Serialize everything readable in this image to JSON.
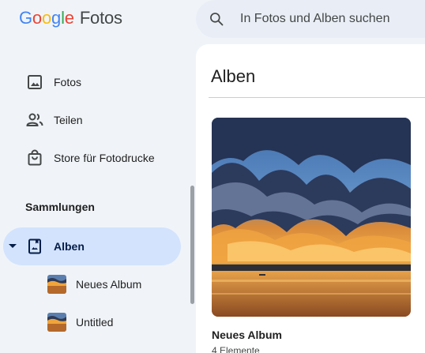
{
  "app": {
    "logo_letters": [
      "G",
      "o",
      "o",
      "g",
      "l",
      "e"
    ],
    "logo_colors": [
      "#4285f4",
      "#ea4335",
      "#fbbc05",
      "#4285f4",
      "#34a853",
      "#ea4335"
    ],
    "product_name": "Fotos"
  },
  "search": {
    "placeholder": "In Fotos und Alben suchen",
    "icon": "search-icon"
  },
  "sidebar": {
    "items": [
      {
        "label": "Fotos",
        "icon": "photo-icon"
      },
      {
        "label": "Teilen",
        "icon": "people-icon"
      },
      {
        "label": "Store für Fotodrucke",
        "icon": "shopping-bag-icon"
      }
    ],
    "section_title": "Sammlungen",
    "active_item": {
      "label": "Alben",
      "icon": "album-icon",
      "expanded": true
    },
    "sub_items": [
      {
        "label": "Neues Album"
      },
      {
        "label": "Untitled"
      }
    ]
  },
  "main": {
    "title": "Alben",
    "albums": [
      {
        "name": "Neues Album",
        "count": "4 Elemente"
      }
    ]
  },
  "colors": {
    "accent": "#d3e3fd",
    "background": "#f0f4f9"
  }
}
